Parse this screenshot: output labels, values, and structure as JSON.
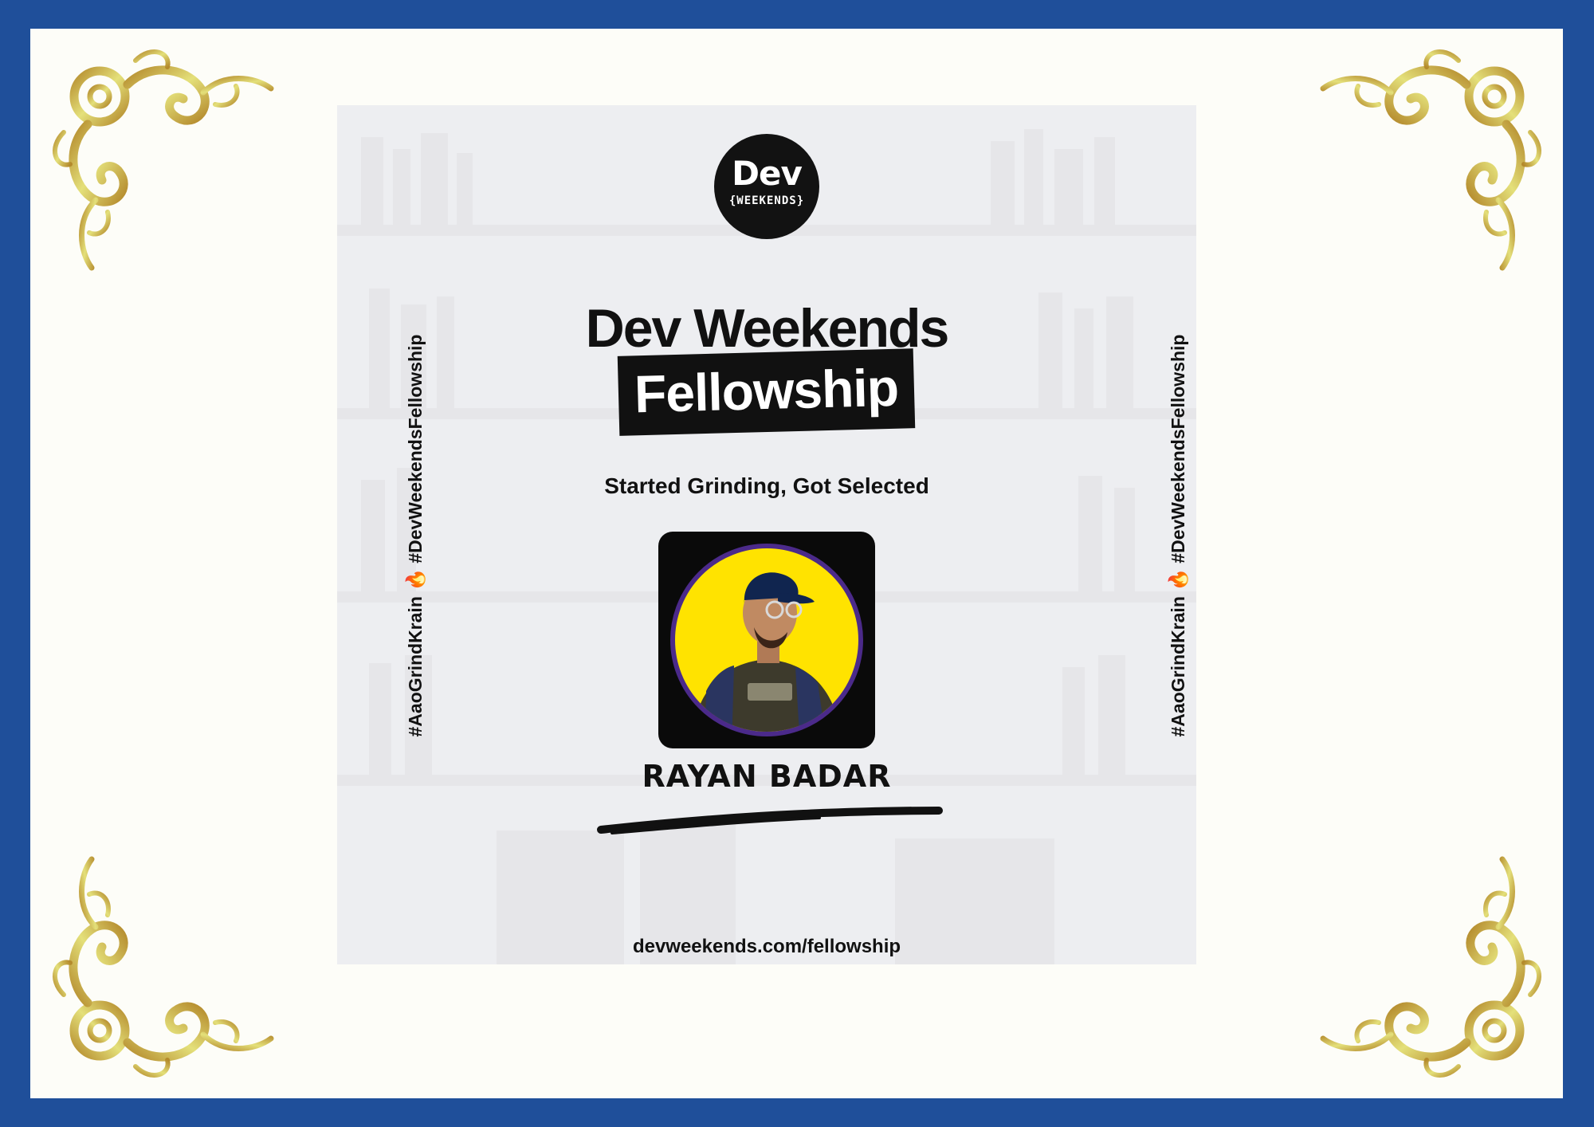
{
  "colors": {
    "border_blue": "#1f4f9a",
    "paper": "#fdfdf8",
    "gold_light": "#e4e07a",
    "gold_dark": "#b48a2c",
    "ink": "#111111",
    "photo_yellow": "#ffe300",
    "photo_ring": "#4b2a8a"
  },
  "logo": {
    "main": "Dev",
    "sub": "{WEEKENDS}"
  },
  "heading": {
    "title": "Dev Weekends",
    "badge": "Fellowship"
  },
  "tagline": "Started Grinding, Got Selected",
  "person": {
    "name": "RAYAN BADAR",
    "photo_icon": "profile-photo"
  },
  "hashtags": {
    "first": "#AaoGrindKrain",
    "emoji": "🔥",
    "second": "#DevWeekendsFellowship"
  },
  "footer": {
    "url": "devweekends.com/fellowship"
  },
  "ornaments": {
    "icon": "gold-flourish-corner-icon"
  }
}
